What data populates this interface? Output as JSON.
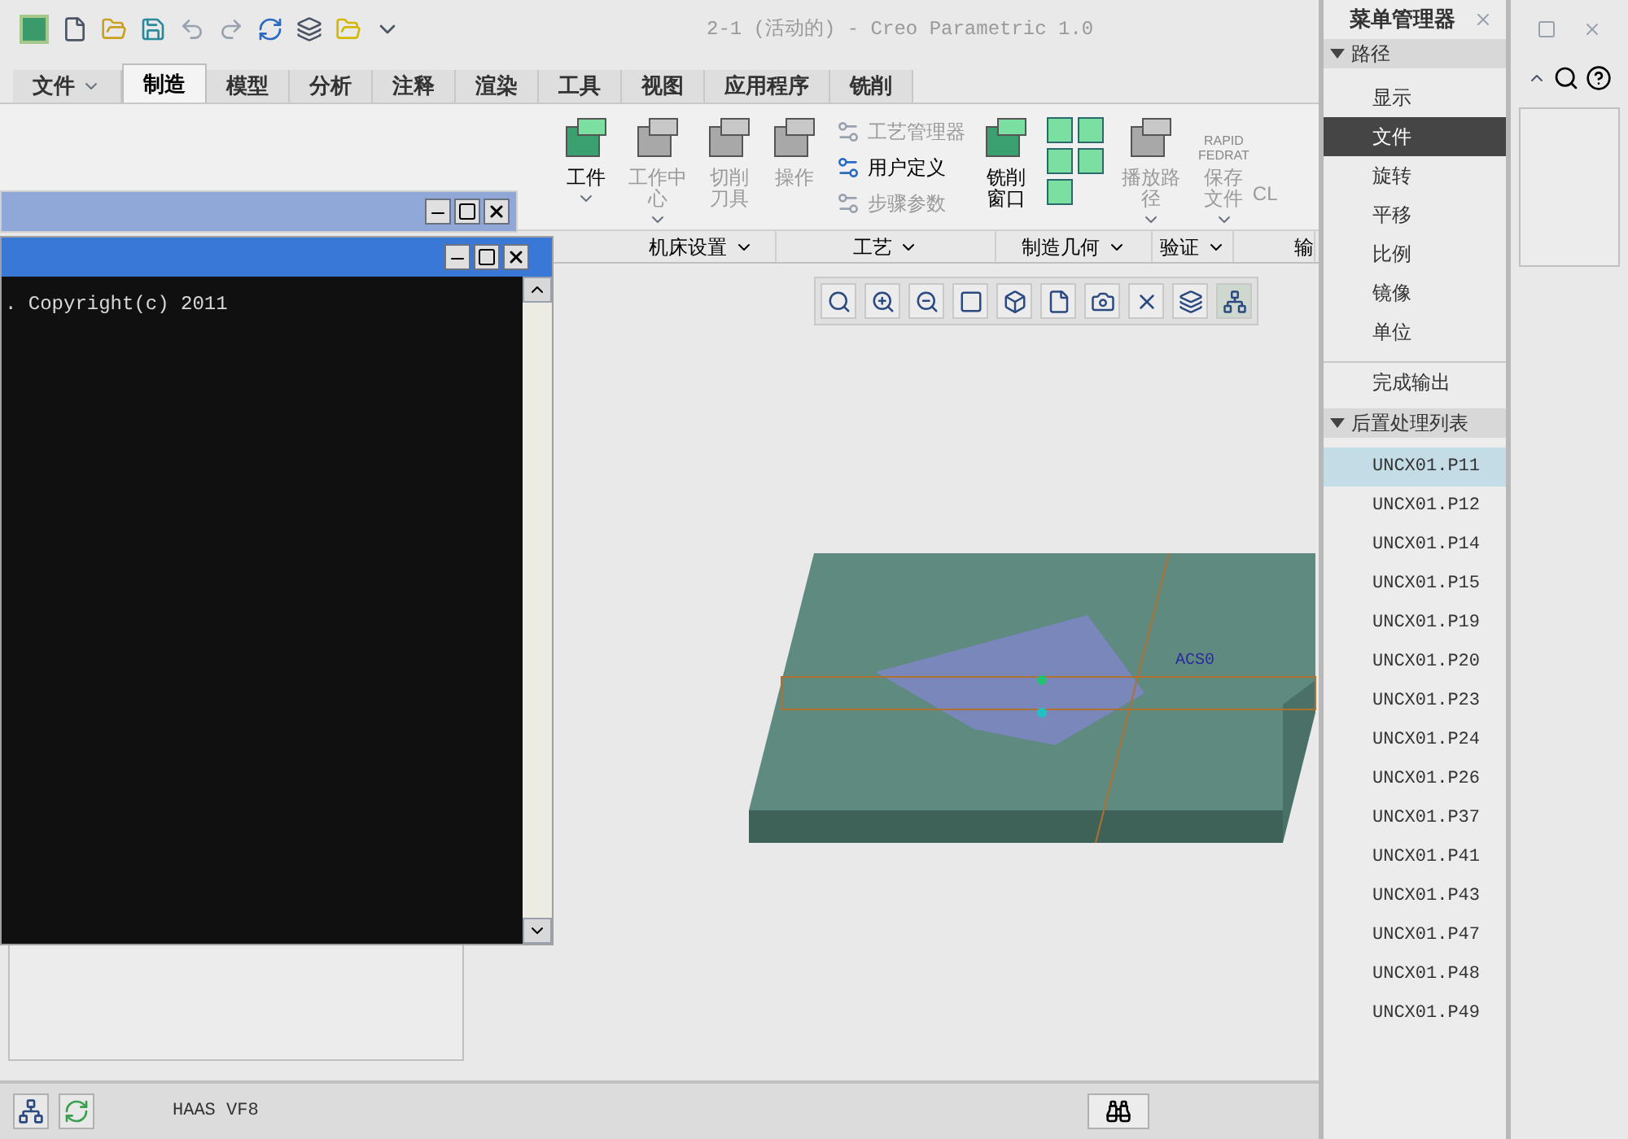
{
  "window": {
    "title": "2-1 (活动的) - Creo Parametric 1.0"
  },
  "tabs": [
    {
      "label": "文件",
      "kind": "menu",
      "selected": false
    },
    {
      "label": "制造",
      "kind": "tab",
      "selected": true
    },
    {
      "label": "模型",
      "kind": "tab",
      "selected": false
    },
    {
      "label": "分析",
      "kind": "tab",
      "selected": false
    },
    {
      "label": "注释",
      "kind": "tab",
      "selected": false
    },
    {
      "label": "渲染",
      "kind": "tab",
      "selected": false
    },
    {
      "label": "工具",
      "kind": "tab",
      "selected": false
    },
    {
      "label": "视图",
      "kind": "tab",
      "selected": false
    },
    {
      "label": "应用程序",
      "kind": "tab",
      "selected": false
    },
    {
      "label": "铣削",
      "kind": "tab",
      "selected": false
    }
  ],
  "ribbon": {
    "buttons": [
      {
        "kind": "large",
        "label": "工件",
        "disabled": false,
        "dropdown": true
      },
      {
        "kind": "large",
        "label": "工作中心",
        "disabled": true,
        "dropdown": true
      },
      {
        "kind": "large",
        "label": "切削刀具",
        "disabled": true,
        "dropdown": false
      },
      {
        "kind": "large",
        "label": "操作",
        "disabled": true,
        "dropdown": false
      },
      {
        "kind": "stack",
        "items": [
          {
            "label": "工艺管理器",
            "disabled": true
          },
          {
            "label": "用户定义",
            "disabled": false
          },
          {
            "label": "步骤参数",
            "disabled": true
          }
        ]
      },
      {
        "kind": "large",
        "label": "铣削窗口",
        "disabled": false,
        "dropdown": false
      },
      {
        "kind": "grid"
      },
      {
        "kind": "large",
        "label": "播放路径",
        "disabled": true,
        "dropdown": true
      },
      {
        "kind": "rapid",
        "icon_lines": [
          "RAPID",
          "FEDRAT"
        ],
        "label": "保存文件",
        "disabled": true,
        "dropdown": true
      },
      {
        "kind": "cut",
        "label": "CL"
      }
    ],
    "groups": [
      {
        "label": "机床设置"
      },
      {
        "label": "工艺"
      },
      {
        "label": "制造几何"
      },
      {
        "label": "验证"
      },
      {
        "label": "输"
      }
    ]
  },
  "console_windows": [
    {
      "active": false
    },
    {
      "active": true,
      "text": ". Copyright(c) 2011"
    }
  ],
  "model": {
    "csys_label": "ACS0"
  },
  "status_bar": {
    "machine": "HAAS VF8"
  },
  "menu_manager": {
    "title": "菜单管理器",
    "sections": [
      {
        "title": "路径",
        "expanded": true,
        "items": [
          {
            "label": "显示",
            "selected": false
          },
          {
            "label": "文件",
            "selected": true
          },
          {
            "label": "旋转",
            "selected": false
          },
          {
            "label": "平移",
            "selected": false
          },
          {
            "label": "比例",
            "selected": false
          },
          {
            "label": "镜像",
            "selected": false
          },
          {
            "label": "单位",
            "selected": false
          }
        ],
        "done": "完成输出"
      },
      {
        "title": "后置处理列表",
        "expanded": true,
        "items": [
          {
            "label": "UNCX01.P11",
            "selected": true
          },
          {
            "label": "UNCX01.P12",
            "selected": false
          },
          {
            "label": "UNCX01.P14",
            "selected": false
          },
          {
            "label": "UNCX01.P15",
            "selected": false
          },
          {
            "label": "UNCX01.P19",
            "selected": false
          },
          {
            "label": "UNCX01.P20",
            "selected": false
          },
          {
            "label": "UNCX01.P23",
            "selected": false
          },
          {
            "label": "UNCX01.P24",
            "selected": false
          },
          {
            "label": "UNCX01.P26",
            "selected": false
          },
          {
            "label": "UNCX01.P37",
            "selected": false
          },
          {
            "label": "UNCX01.P41",
            "selected": false
          },
          {
            "label": "UNCX01.P43",
            "selected": false
          },
          {
            "label": "UNCX01.P47",
            "selected": false
          },
          {
            "label": "UNCX01.P48",
            "selected": false
          },
          {
            "label": "UNCX01.P49",
            "selected": false
          }
        ]
      }
    ]
  }
}
